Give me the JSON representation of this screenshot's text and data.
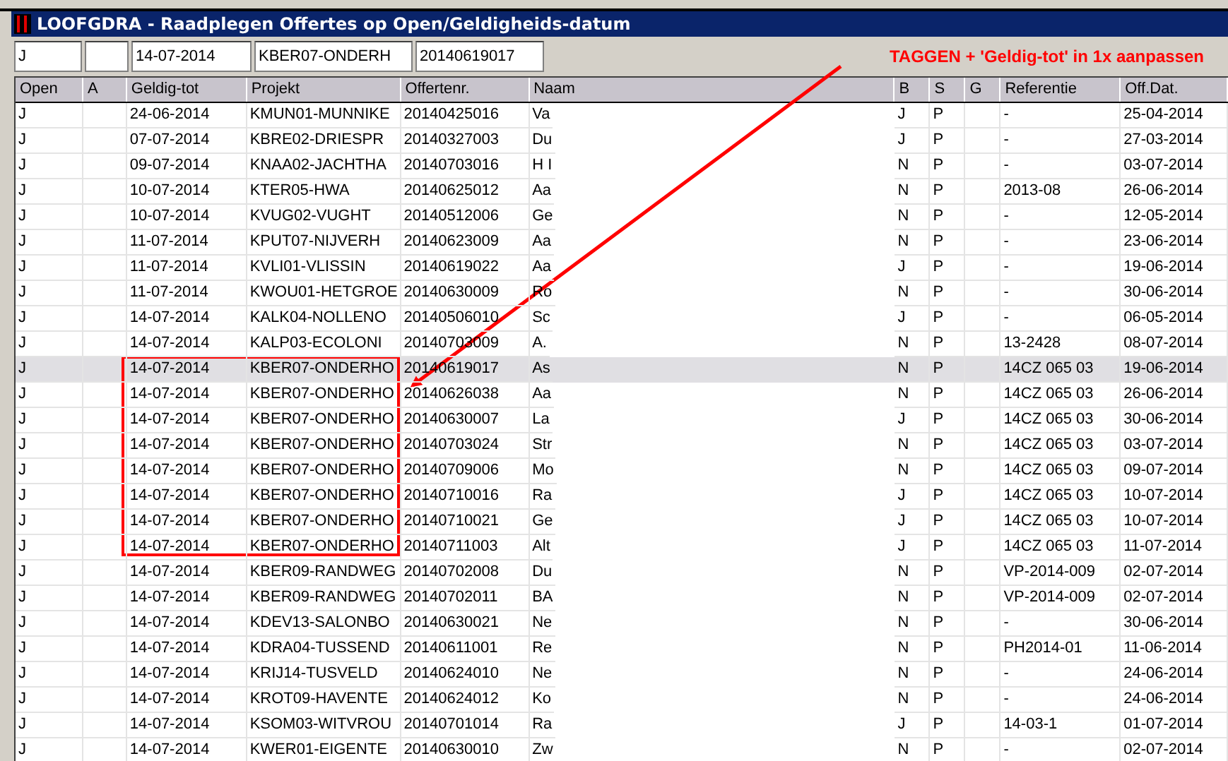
{
  "window": {
    "title": "LOOFGDRA - Raadplegen Offertes op Open/Geldigheids-datum"
  },
  "fields": [
    {
      "kind": "text",
      "value": "J"
    },
    {
      "kind": "blank"
    },
    {
      "kind": "text",
      "value": "14-07-2014"
    },
    {
      "kind": "text",
      "value": "KBER07-ONDERH"
    },
    {
      "kind": "text",
      "value": "20140619017"
    }
  ],
  "annotation": {
    "text": "TAGGEN + 'Geldig-tot' in 1x aanpassen"
  },
  "table": {
    "columns": [
      "Open",
      "A",
      "Geldig-tot",
      "Projekt",
      "Offertenr.",
      "Naam",
      "B",
      "S",
      "G",
      "Referentie",
      "Off.Dat."
    ],
    "rows": [
      {
        "open": "J",
        "geldig": "24-06-2014",
        "projekt": "KMUN01-MUNNIKE",
        "offertenr": "20140425016",
        "naam": "Va",
        "b": "J",
        "s": "P",
        "ref": "-",
        "offdat": "25-04-2014",
        "selected": false
      },
      {
        "open": "J",
        "geldig": "07-07-2014",
        "projekt": "KBRE02-DRIESPR",
        "offertenr": "20140327003",
        "naam": "Du",
        "b": "J",
        "s": "P",
        "ref": "-",
        "offdat": "27-03-2014",
        "selected": false
      },
      {
        "open": "J",
        "geldig": "09-07-2014",
        "projekt": "KNAA02-JACHTHA",
        "offertenr": "20140703016",
        "naam": "H I",
        "b": "N",
        "s": "P",
        "ref": "-",
        "offdat": "03-07-2014",
        "selected": false
      },
      {
        "open": "J",
        "geldig": "10-07-2014",
        "projekt": "KTER05-HWA",
        "offertenr": "20140625012",
        "naam": "Aa",
        "b": "N",
        "s": "P",
        "ref": "2013-08",
        "offdat": "26-06-2014",
        "selected": false
      },
      {
        "open": "J",
        "geldig": "10-07-2014",
        "projekt": "KVUG02-VUGHT",
        "offertenr": "20140512006",
        "naam": "Ge",
        "b": "N",
        "s": "P",
        "ref": "-",
        "offdat": "12-05-2014",
        "selected": false
      },
      {
        "open": "J",
        "geldig": "11-07-2014",
        "projekt": "KPUT07-NIJVERH",
        "offertenr": "20140623009",
        "naam": "Aa",
        "b": "N",
        "s": "P",
        "ref": "-",
        "offdat": "23-06-2014",
        "selected": false
      },
      {
        "open": "J",
        "geldig": "11-07-2014",
        "projekt": "KVLI01-VLISSIN",
        "offertenr": "20140619022",
        "naam": "Aa",
        "b": "J",
        "s": "P",
        "ref": "-",
        "offdat": "19-06-2014",
        "selected": false
      },
      {
        "open": "J",
        "geldig": "11-07-2014",
        "projekt": "KWOU01-HETGROE",
        "offertenr": "20140630009",
        "naam": "Ro",
        "b": "N",
        "s": "P",
        "ref": "-",
        "offdat": "30-06-2014",
        "selected": false
      },
      {
        "open": "J",
        "geldig": "14-07-2014",
        "projekt": "KALK04-NOLLENO",
        "offertenr": "20140506010",
        "naam": "Sc",
        "b": "J",
        "s": "P",
        "ref": "-",
        "offdat": "06-05-2014",
        "selected": false
      },
      {
        "open": "J",
        "geldig": "14-07-2014",
        "projekt": "KALP03-ECOLONI",
        "offertenr": "20140703009",
        "naam": "A.",
        "b": "N",
        "s": "P",
        "ref": "13-2428",
        "offdat": "08-07-2014",
        "selected": false
      },
      {
        "open": "J",
        "geldig": "14-07-2014",
        "projekt": "KBER07-ONDERHO",
        "offertenr": "20140619017",
        "naam": "As",
        "b": "N",
        "s": "P",
        "ref": "14CZ 065 03",
        "offdat": "19-06-2014",
        "selected": true
      },
      {
        "open": "J",
        "geldig": "14-07-2014",
        "projekt": "KBER07-ONDERHO",
        "offertenr": "20140626038",
        "naam": "Aa",
        "b": "N",
        "s": "P",
        "ref": "14CZ 065 03",
        "offdat": "26-06-2014",
        "selected": false
      },
      {
        "open": "J",
        "geldig": "14-07-2014",
        "projekt": "KBER07-ONDERHO",
        "offertenr": "20140630007",
        "naam": "La",
        "b": "J",
        "s": "P",
        "ref": "14CZ 065 03",
        "offdat": "30-06-2014",
        "selected": false
      },
      {
        "open": "J",
        "geldig": "14-07-2014",
        "projekt": "KBER07-ONDERHO",
        "offertenr": "20140703024",
        "naam": "Str",
        "b": "N",
        "s": "P",
        "ref": "14CZ 065 03",
        "offdat": "03-07-2014",
        "selected": false
      },
      {
        "open": "J",
        "geldig": "14-07-2014",
        "projekt": "KBER07-ONDERHO",
        "offertenr": "20140709006",
        "naam": "Mo",
        "b": "N",
        "s": "P",
        "ref": "14CZ 065 03",
        "offdat": "09-07-2014",
        "selected": false
      },
      {
        "open": "J",
        "geldig": "14-07-2014",
        "projekt": "KBER07-ONDERHO",
        "offertenr": "20140710016",
        "naam": "Ra",
        "b": "J",
        "s": "P",
        "ref": "14CZ 065 03",
        "offdat": "10-07-2014",
        "selected": false
      },
      {
        "open": "J",
        "geldig": "14-07-2014",
        "projekt": "KBER07-ONDERHO",
        "offertenr": "20140710021",
        "naam": "Ge",
        "b": "J",
        "s": "P",
        "ref": "14CZ 065 03",
        "offdat": "10-07-2014",
        "selected": false
      },
      {
        "open": "J",
        "geldig": "14-07-2014",
        "projekt": "KBER07-ONDERHO",
        "offertenr": "20140711003",
        "naam": "Alt",
        "b": "J",
        "s": "P",
        "ref": "14CZ 065 03",
        "offdat": "11-07-2014",
        "selected": false
      },
      {
        "open": "J",
        "geldig": "14-07-2014",
        "projekt": "KBER09-RANDWEG",
        "offertenr": "20140702008",
        "naam": "Du",
        "b": "N",
        "s": "P",
        "ref": "VP-2014-009",
        "offdat": "02-07-2014",
        "selected": false
      },
      {
        "open": "J",
        "geldig": "14-07-2014",
        "projekt": "KBER09-RANDWEG",
        "offertenr": "20140702011",
        "naam": "BA",
        "b": "N",
        "s": "P",
        "ref": "VP-2014-009",
        "offdat": "02-07-2014",
        "selected": false
      },
      {
        "open": "J",
        "geldig": "14-07-2014",
        "projekt": "KDEV13-SALONBO",
        "offertenr": "20140630021",
        "naam": "Ne",
        "b": "N",
        "s": "P",
        "ref": "-",
        "offdat": "30-06-2014",
        "selected": false
      },
      {
        "open": "J",
        "geldig": "14-07-2014",
        "projekt": "KDRA04-TUSSEND",
        "offertenr": "20140611001",
        "naam": "Re",
        "b": "N",
        "s": "P",
        "ref": "PH2014-01",
        "offdat": "11-06-2014",
        "selected": false
      },
      {
        "open": "J",
        "geldig": "14-07-2014",
        "projekt": "KRIJ14-TUSVELD",
        "offertenr": "20140624010",
        "naam": "Ne",
        "b": "N",
        "s": "P",
        "ref": "-",
        "offdat": "24-06-2014",
        "selected": false
      },
      {
        "open": "J",
        "geldig": "14-07-2014",
        "projekt": "KROT09-HAVENTE",
        "offertenr": "20140624012",
        "naam": "Ko",
        "b": "N",
        "s": "P",
        "ref": "-",
        "offdat": "24-06-2014",
        "selected": false
      },
      {
        "open": "J",
        "geldig": "14-07-2014",
        "projekt": "KSOM03-WITVROU",
        "offertenr": "20140701014",
        "naam": "Ra",
        "b": "J",
        "s": "P",
        "ref": "14-03-1",
        "offdat": "01-07-2014",
        "selected": false
      },
      {
        "open": "J",
        "geldig": "14-07-2014",
        "projekt": "KWER01-EIGENTE",
        "offertenr": "20140630010",
        "naam": "Zw",
        "b": "N",
        "s": "P",
        "ref": "-",
        "offdat": "02-07-2014",
        "selected": false
      }
    ]
  }
}
